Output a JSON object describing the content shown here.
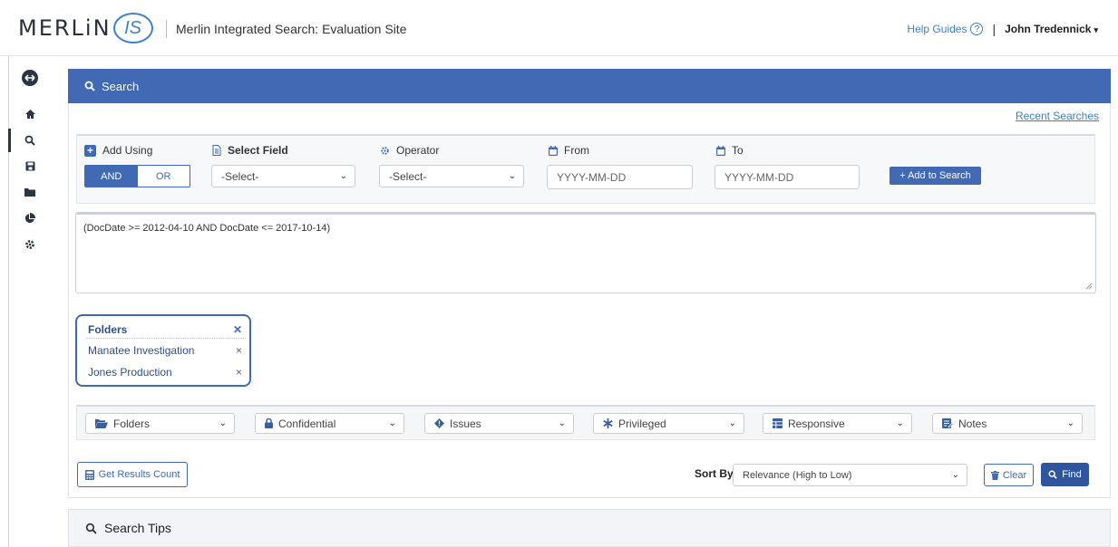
{
  "header": {
    "logo_text": "MERLiN",
    "logo_badge": "IS",
    "app_title": "Merlin Integrated Search: Evaluation Site",
    "help_label": "Help Guides",
    "help_glyph": "?",
    "separator": "|",
    "user_name": "John Tredennick",
    "caret": "▾"
  },
  "sidebar": {
    "items": [
      {
        "icon": "collapse-icon"
      },
      {
        "icon": "home-icon"
      },
      {
        "icon": "search-icon"
      },
      {
        "icon": "save-icon"
      },
      {
        "icon": "folder-icon"
      },
      {
        "icon": "chart-icon"
      },
      {
        "icon": "gear-icon"
      }
    ]
  },
  "search_panel": {
    "title": "Search",
    "recent_link": "Recent Searches"
  },
  "builder": {
    "add_using_label": "Add Using",
    "and_label": "AND",
    "or_label": "OR",
    "field_label": "Select Field",
    "field_value": "-Select-",
    "operator_label": "Operator",
    "operator_value": "-Select-",
    "from_label": "From",
    "from_placeholder": "YYYY-MM-DD",
    "to_label": "To",
    "to_placeholder": "YYYY-MM-DD",
    "add_button": "+ Add to Search",
    "chevron": "⌄"
  },
  "query": {
    "text": "(DocDate >= 2012-04-10 AND DocDate <= 2017-10-14)"
  },
  "folder_filter": {
    "title": "Folders",
    "close": "✕",
    "items": [
      {
        "label": "Manatee Investigation",
        "remove": "×"
      },
      {
        "label": "Jones Production",
        "remove": "×"
      }
    ]
  },
  "filters": [
    {
      "label": "Folders",
      "icon": "folder-open-icon"
    },
    {
      "label": "Confidential",
      "icon": "lock-icon"
    },
    {
      "label": "Issues",
      "icon": "diamond-icon"
    },
    {
      "label": "Privileged",
      "icon": "asterisk-icon"
    },
    {
      "label": "Responsive",
      "icon": "table-icon"
    },
    {
      "label": "Notes",
      "icon": "notes-icon"
    }
  ],
  "actions": {
    "count_button": "Get Results Count",
    "sort_label": "Sort By",
    "sort_value": "Relevance (High to Low)",
    "clear_button": "Clear",
    "find_button": "Find"
  },
  "tips": {
    "title": "Search Tips"
  },
  "colors": {
    "accent": "#4169b4",
    "nav_dark": "#2a3548"
  }
}
